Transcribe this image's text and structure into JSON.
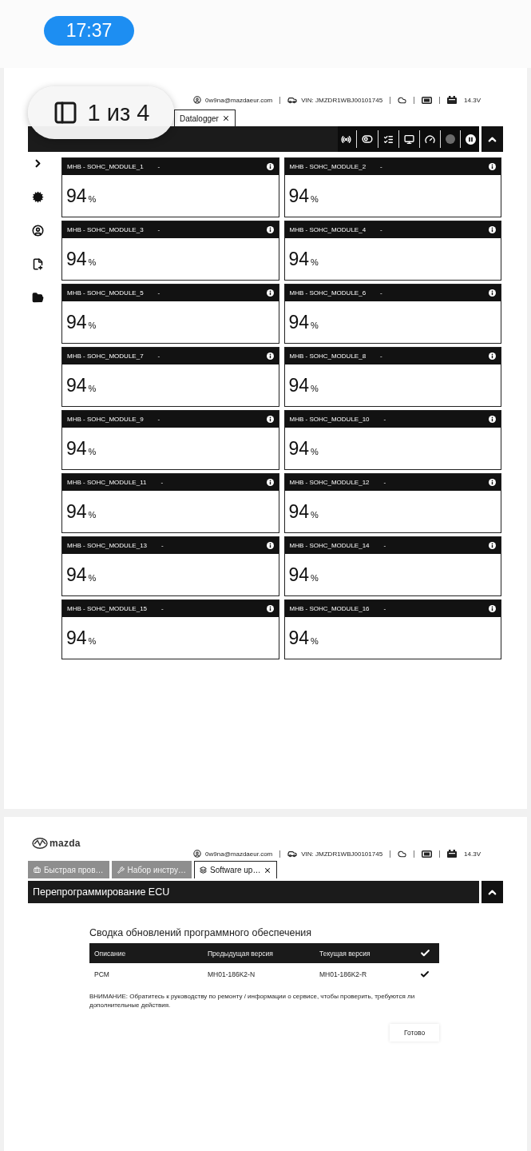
{
  "status_bar": {
    "time": "17:37"
  },
  "viewer": {
    "counter": "1 из 4"
  },
  "datalogger_page": {
    "header": {
      "user": "0w9na@mazdaeur.com",
      "vin": "VIN: JMZDR1WBJ00101745",
      "voltage": "14.3V"
    },
    "tabs": [
      {
        "label": "Datalogger",
        "selected": true
      }
    ],
    "modules": [
      {
        "name": "MHB - SOHC_MODULE_1",
        "suffix": "-",
        "value": "94",
        "unit": "%"
      },
      {
        "name": "MHB - SOHC_MODULE_2",
        "suffix": "-",
        "value": "94",
        "unit": "%"
      },
      {
        "name": "MHB - SOHC_MODULE_3",
        "suffix": "-",
        "value": "94",
        "unit": "%"
      },
      {
        "name": "MHB - SOHC_MODULE_4",
        "suffix": "-",
        "value": "94",
        "unit": "%"
      },
      {
        "name": "MHB - SOHC_MODULE_5",
        "suffix": "-",
        "value": "94",
        "unit": "%"
      },
      {
        "name": "MHB - SOHC_MODULE_6",
        "suffix": "-",
        "value": "94",
        "unit": "%"
      },
      {
        "name": "MHB - SOHC_MODULE_7",
        "suffix": "-",
        "value": "94",
        "unit": "%"
      },
      {
        "name": "MHB - SOHC_MODULE_8",
        "suffix": "-",
        "value": "94",
        "unit": "%"
      },
      {
        "name": "MHB - SOHC_MODULE_9",
        "suffix": "-",
        "value": "94",
        "unit": "%"
      },
      {
        "name": "MHB - SOHC_MODULE_10",
        "suffix": "-",
        "value": "94",
        "unit": "%"
      },
      {
        "name": "MHB - SOHC_MODULE_11",
        "suffix": "-",
        "value": "94",
        "unit": "%"
      },
      {
        "name": "MHB - SOHC_MODULE_12",
        "suffix": "-",
        "value": "94",
        "unit": "%"
      },
      {
        "name": "MHB - SOHC_MODULE_13",
        "suffix": "-",
        "value": "94",
        "unit": "%"
      },
      {
        "name": "MHB - SOHC_MODULE_14",
        "suffix": "-",
        "value": "94",
        "unit": "%"
      },
      {
        "name": "MHB - SOHC_MODULE_15",
        "suffix": "-",
        "value": "94",
        "unit": "%"
      },
      {
        "name": "MHB - SOHC_MODULE_16",
        "suffix": "-",
        "value": "94",
        "unit": "%"
      }
    ]
  },
  "reprogramming_page": {
    "logo": "mazda",
    "header": {
      "user": "0w9na@mazdaeur.com",
      "vin": "VIN: JMZDR1WBJ00101745",
      "voltage": "14.3V"
    },
    "tabs": [
      {
        "label": "Быстрая пров…",
        "selected": false
      },
      {
        "label": "Набор инстру…",
        "selected": false
      },
      {
        "label": "Software up…",
        "selected": true
      }
    ],
    "title": "Перепрограммирование ECU",
    "summary": {
      "title": "Сводка обновлений программного обеспечения",
      "columns": [
        "Описание",
        "Предыдущая версия",
        "Текущая версия"
      ],
      "all_checked": true,
      "rows": [
        {
          "cells": [
            "PCM",
            "MH01-186K2-N",
            "MH01-186K2-R"
          ],
          "checked": true
        }
      ],
      "warning": "ВНИМАНИЕ: Обратитесь к руководству по ремонту / информации о сервисе, чтобы проверить, требуются ли дополнительные действия.",
      "done_button": "Готово"
    }
  }
}
